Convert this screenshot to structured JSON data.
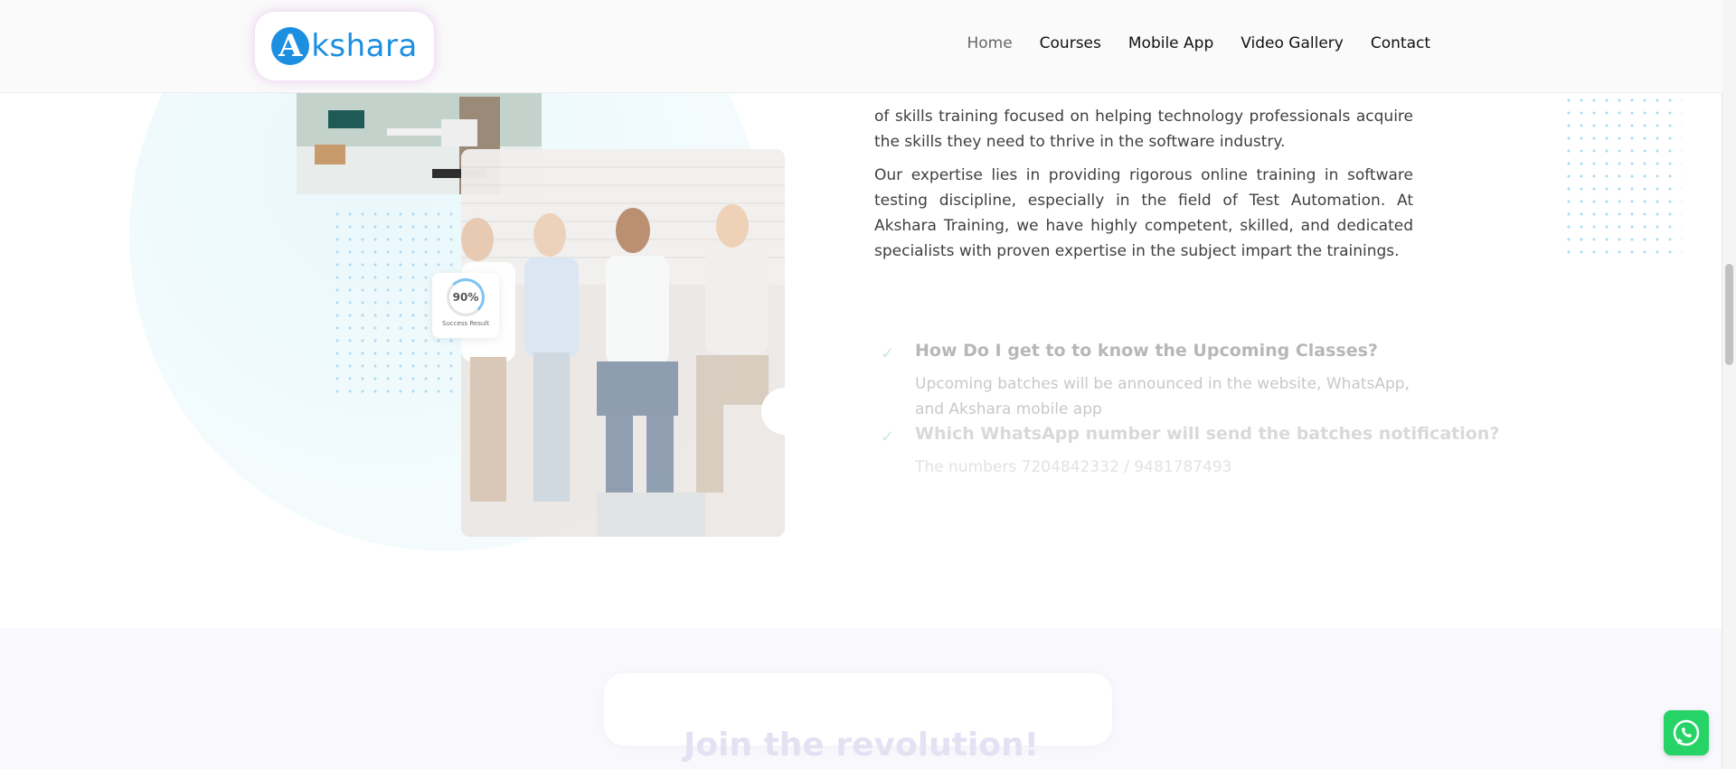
{
  "brand": {
    "logo_letter": "A",
    "logo_text": "kshara",
    "color": "#1c8fe0"
  },
  "nav": [
    {
      "label": "Home",
      "active": true
    },
    {
      "label": "Courses"
    },
    {
      "label": "Mobile App"
    },
    {
      "label": "Video Gallery"
    },
    {
      "label": "Contact"
    }
  ],
  "about": {
    "paragraph1": "of skills training focused on helping technology professionals acquire the skills they need to thrive in the software industry.",
    "paragraph2": "Our expertise lies in providing rigorous online training in  software testing discipline, especially in the field of Test Automation. At Akshara Training, we have highly competent, skilled, and dedicated specialists with proven expertise in the subject impart the trainings."
  },
  "badge": {
    "value": "90%",
    "label": "Success Result",
    "progress": 0.9
  },
  "faq": [
    {
      "question": "How Do I get to to know the Upcoming Classes?",
      "answer": "Upcoming batches will be announced in the website, WhatsApp, and Akshara mobile app"
    },
    {
      "question": "Which WhatsApp number will send the batches notification?",
      "answer": "The numbers 7204842332 / 9481787493"
    }
  ],
  "cta": {
    "title": "Join the revolution!"
  },
  "icons": {
    "faq_check": "check-icon",
    "whatsapp": "whatsapp-icon"
  },
  "colors": {
    "accent": "#1c8fe0",
    "whatsapp": "#25d366",
    "check": "#c9e8df"
  }
}
